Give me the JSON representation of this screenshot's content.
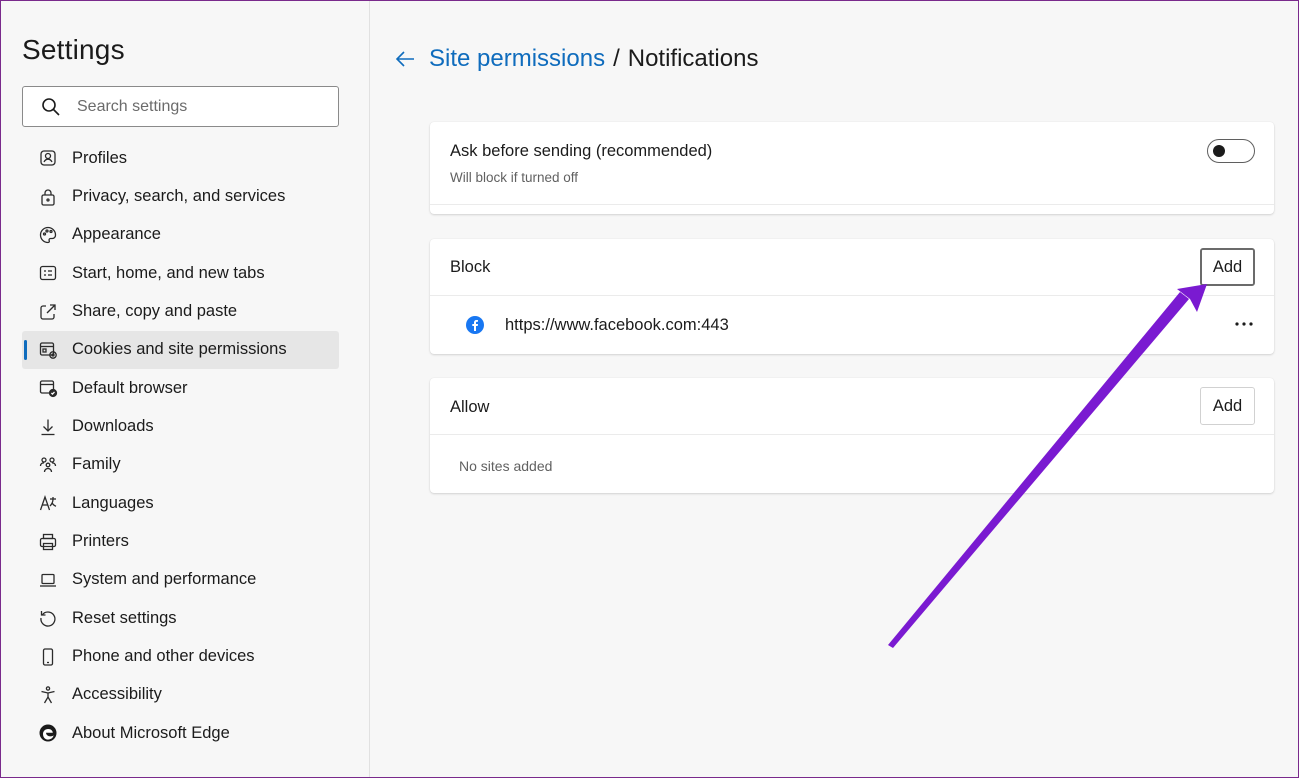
{
  "sidebar": {
    "title": "Settings",
    "search_placeholder": "Search settings",
    "items": [
      {
        "label": "Profiles",
        "icon": "profile-icon"
      },
      {
        "label": "Privacy, search, and services",
        "icon": "lock-icon"
      },
      {
        "label": "Appearance",
        "icon": "palette-icon"
      },
      {
        "label": "Start, home, and new tabs",
        "icon": "start-tabs-icon"
      },
      {
        "label": "Share, copy and paste",
        "icon": "share-icon"
      },
      {
        "label": "Cookies and site permissions",
        "icon": "cookies-permissions-icon",
        "active": true
      },
      {
        "label": "Default browser",
        "icon": "default-browser-icon"
      },
      {
        "label": "Downloads",
        "icon": "download-icon"
      },
      {
        "label": "Family",
        "icon": "family-icon"
      },
      {
        "label": "Languages",
        "icon": "languages-icon"
      },
      {
        "label": "Printers",
        "icon": "printer-icon"
      },
      {
        "label": "System and performance",
        "icon": "laptop-icon"
      },
      {
        "label": "Reset settings",
        "icon": "reset-icon"
      },
      {
        "label": "Phone and other devices",
        "icon": "phone-icon"
      },
      {
        "label": "Accessibility",
        "icon": "accessibility-icon"
      },
      {
        "label": "About Microsoft Edge",
        "icon": "edge-logo-icon"
      }
    ]
  },
  "header": {
    "parent": "Site permissions",
    "separator": "/",
    "current": "Notifications"
  },
  "ask_card": {
    "title": "Ask before sending (recommended)",
    "subtitle": "Will block if turned off",
    "toggle_on": false
  },
  "block_card": {
    "title": "Block",
    "add_label": "Add",
    "sites": [
      {
        "url": "https://www.facebook.com:443",
        "icon": "facebook-icon"
      }
    ],
    "more_label": "···"
  },
  "allow_card": {
    "title": "Allow",
    "add_label": "Add",
    "empty_text": "No sites added"
  },
  "colors": {
    "accent": "#0f6cbd",
    "annotation_arrow": "#7a1ad1",
    "facebook": "#1877f2"
  }
}
